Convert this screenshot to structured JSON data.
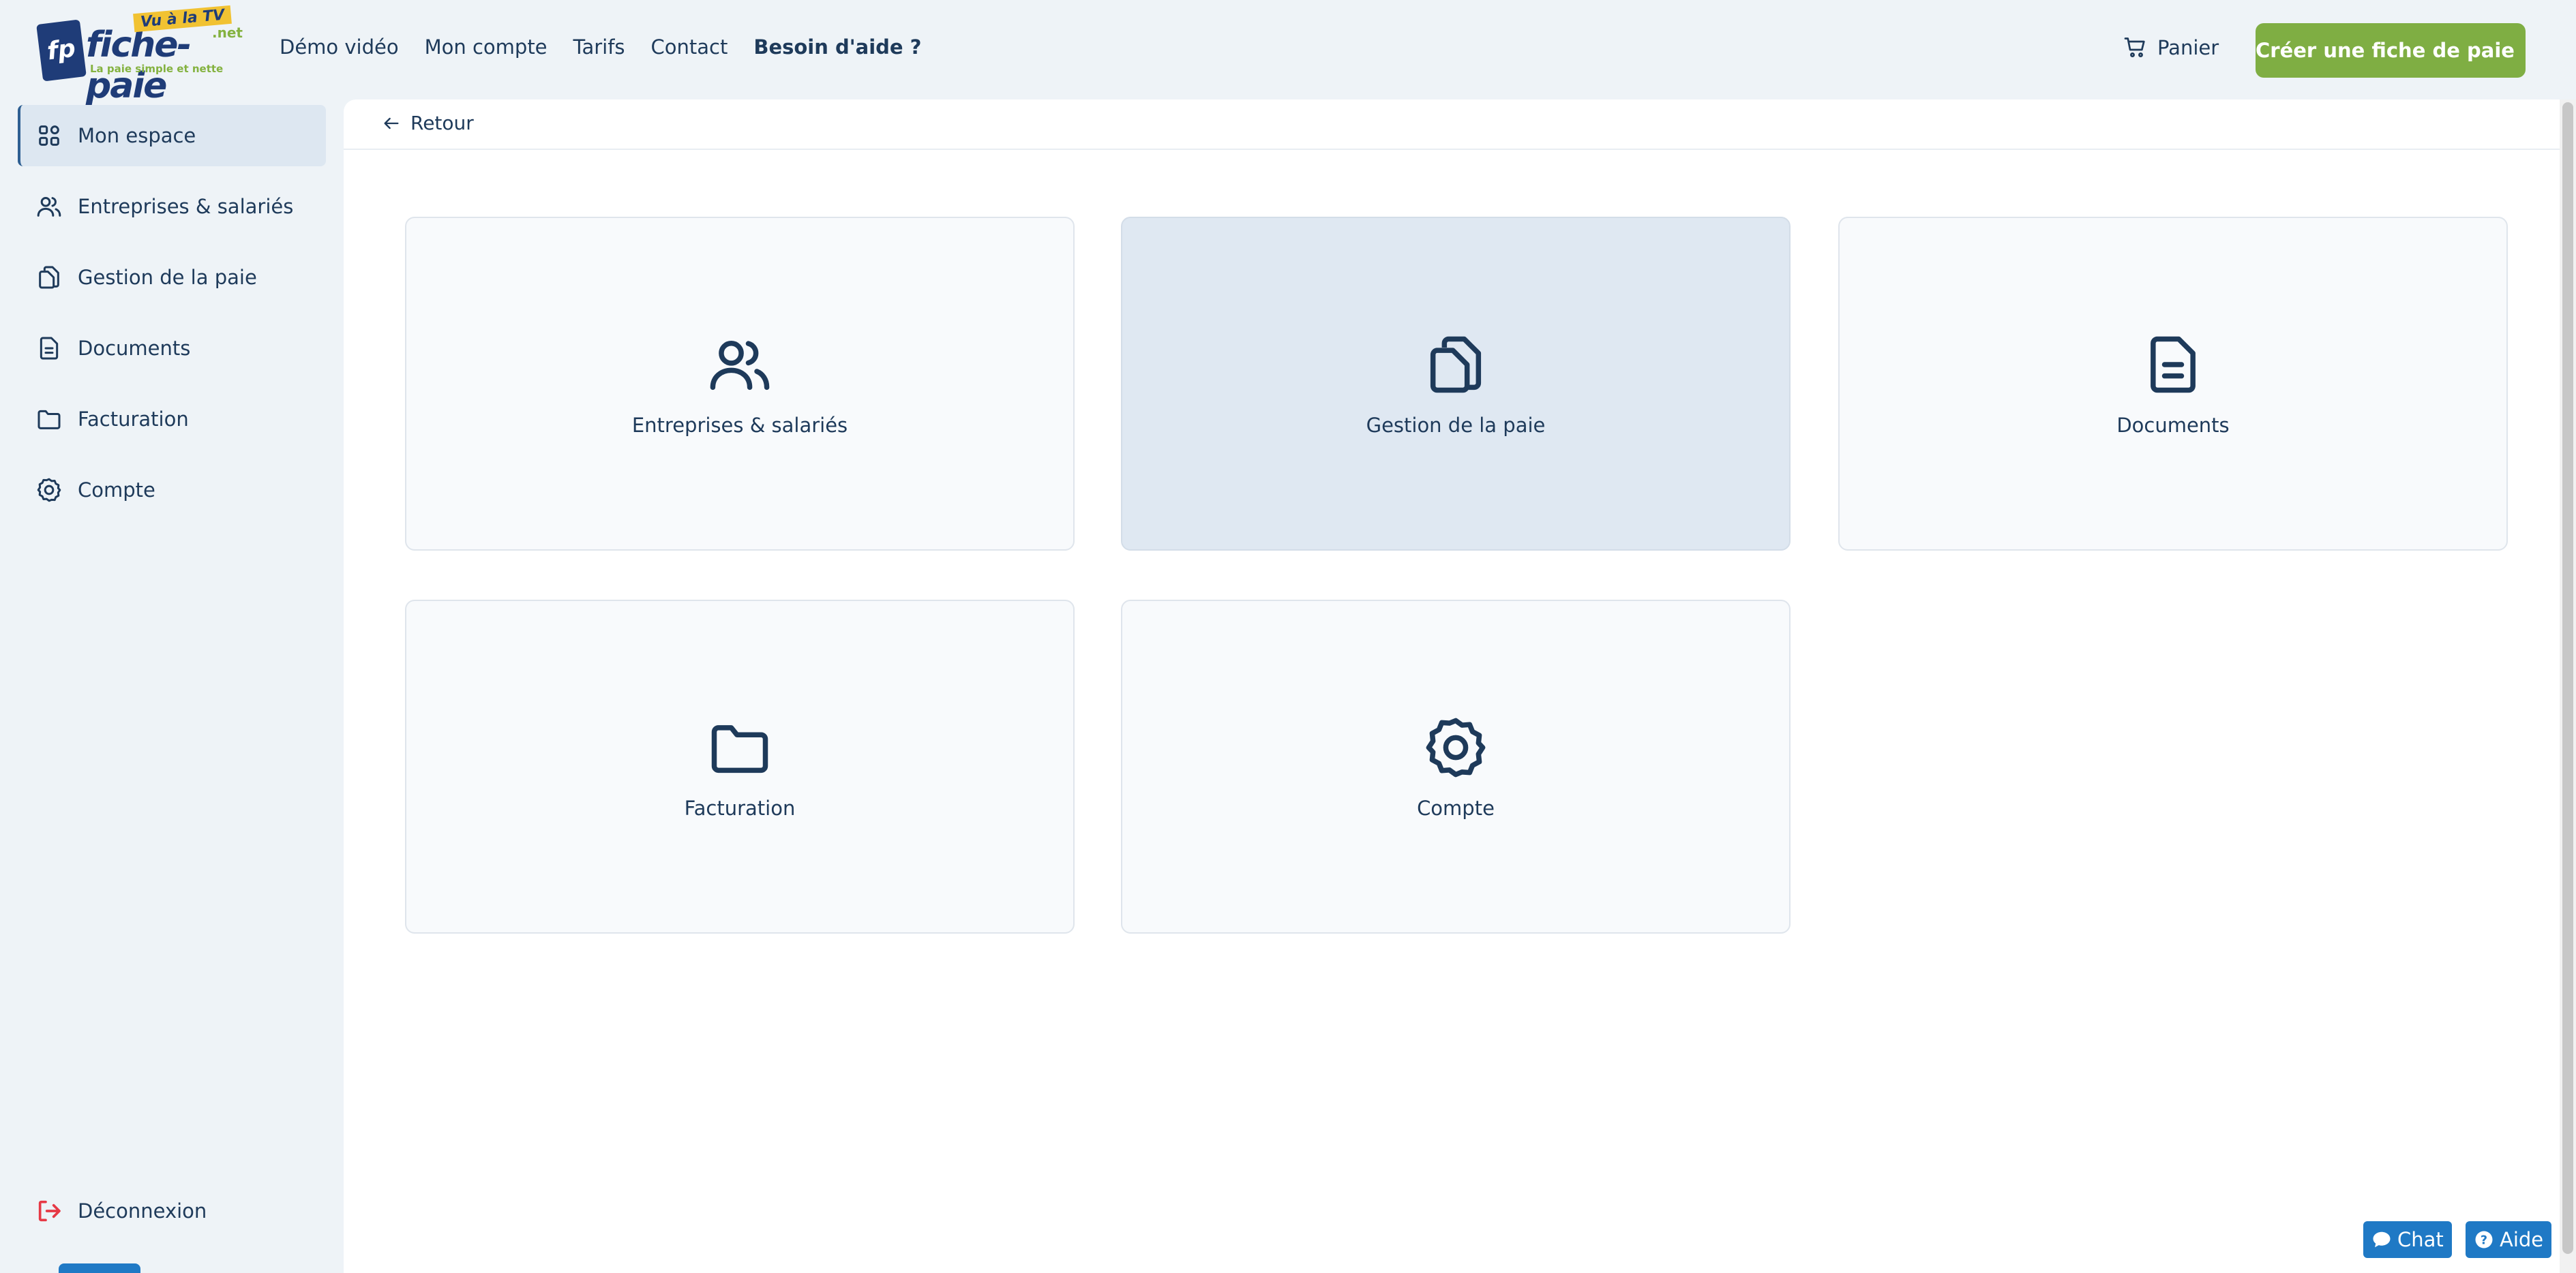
{
  "header": {
    "logo": {
      "mark": "fp",
      "name": "fiche-paie",
      "tld": ".net",
      "tv_badge": "Vu à la TV",
      "tagline": "La paie simple et nette"
    },
    "nav": [
      {
        "label": "Démo vidéo",
        "bold": false
      },
      {
        "label": "Mon compte",
        "bold": false
      },
      {
        "label": "Tarifs",
        "bold": false
      },
      {
        "label": "Contact",
        "bold": false
      },
      {
        "label": "Besoin d'aide ?",
        "bold": true
      }
    ],
    "cart_label": "Panier",
    "cta_label": "Créer une fiche de paie"
  },
  "sidebar": {
    "items": [
      {
        "label": "Mon espace",
        "icon": "grid-icon",
        "active": true
      },
      {
        "label": "Entreprises & salariés",
        "icon": "users-icon",
        "active": false
      },
      {
        "label": "Gestion de la paie",
        "icon": "documents-icon",
        "active": false
      },
      {
        "label": "Documents",
        "icon": "document-icon",
        "active": false
      },
      {
        "label": "Facturation",
        "icon": "folder-icon",
        "active": false
      },
      {
        "label": "Compte",
        "icon": "gear-icon",
        "active": false
      }
    ],
    "logout_label": "Déconnexion"
  },
  "main": {
    "back_label": "Retour",
    "cards": [
      {
        "label": "Entreprises & salariés",
        "icon": "users-icon",
        "highlighted": false
      },
      {
        "label": "Gestion de la paie",
        "icon": "documents-icon",
        "highlighted": true
      },
      {
        "label": "Documents",
        "icon": "document-icon",
        "highlighted": false
      },
      {
        "label": "Facturation",
        "icon": "folder-icon",
        "highlighted": false
      },
      {
        "label": "Compte",
        "icon": "gear-icon",
        "highlighted": false
      }
    ]
  },
  "floating": {
    "chat_label": "Chat",
    "help_label": "Aide"
  },
  "colors": {
    "accent_green": "#7fae43",
    "navy": "#1e3a5a",
    "blue": "#1f79c5",
    "logout_red": "#e63946"
  }
}
